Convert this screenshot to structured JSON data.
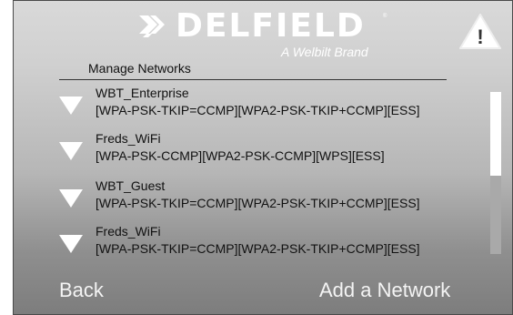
{
  "header": {
    "brand_name": "DELFIELD",
    "brand_registered": "®",
    "tagline": "A Welbilt Brand",
    "logo_icon": "delfield-logo-icon",
    "warning_icon": "warning-icon",
    "warning_symbol": "!"
  },
  "main": {
    "section_title": "Manage Networks",
    "networks": [
      {
        "name": "WBT_Enterprise",
        "security": "[WPA-PSK-TKIP=CCMP][WPA2-PSK-TKIP+CCMP][ESS]"
      },
      {
        "name": "Freds_WiFi",
        "security": "[WPA-PSK-CCMP][WPA2-PSK-CCMP][WPS][ESS]"
      },
      {
        "name": "WBT_Guest",
        "security": "[WPA-PSK-TKIP=CCMP][WPA2-PSK-TKIP+CCMP][ESS]"
      },
      {
        "name": "Freds_WiFi",
        "security": "[WPA-PSK-TKIP=CCMP][WPA2-PSK-TKIP+CCMP][ESS]"
      }
    ],
    "item_icon": "chevron-down-icon",
    "scroll_position": 0.0,
    "scroll_visible_fraction": 0.52
  },
  "footer": {
    "back_label": "Back",
    "add_label": "Add a Network"
  },
  "colors": {
    "text_light": "#ffffff",
    "text_dark": "#111111",
    "chevron": "#ffffff"
  }
}
